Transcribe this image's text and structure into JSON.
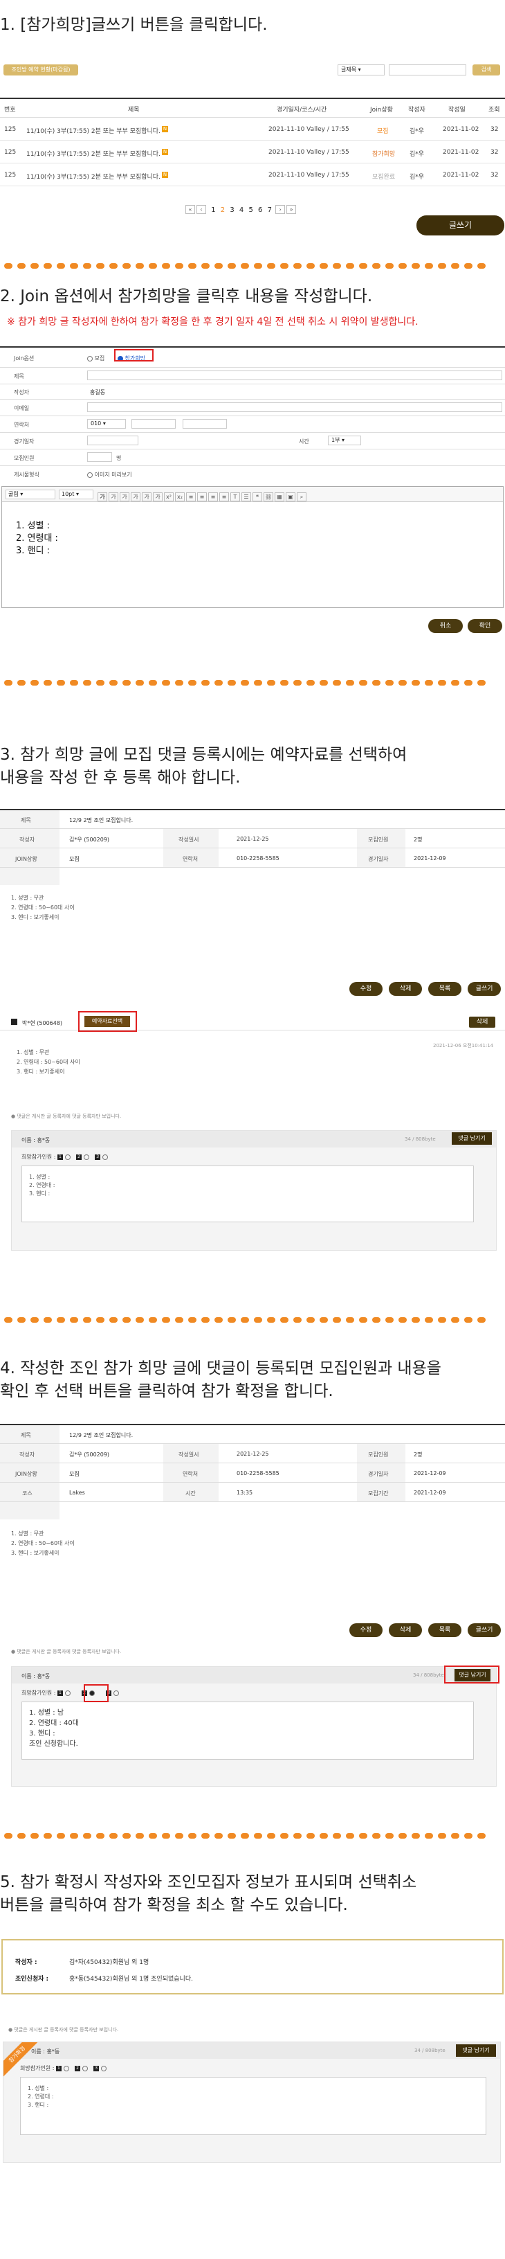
{
  "s1": {
    "heading": "1. [참가희망]글쓰기 버튼을 클릭합니다.",
    "filter_btn": "조인방 예약 현황(마감됨)",
    "search_select": "글제목",
    "search_btn": "검색",
    "cols": [
      "번호",
      "제목",
      "경기일자/코스/시간",
      "Join상황",
      "작성자",
      "작성일",
      "조회"
    ],
    "rows": [
      {
        "no": "125",
        "title": "11/10(수) 3부(17:55) 2분 또는 부부 모집합니다.",
        "info": "2021-11-10 Valley / 17:55",
        "status": "모집",
        "author": "김*우",
        "date": "2021-11-02",
        "views": "32"
      },
      {
        "no": "125",
        "title": "11/10(수) 3부(17:55) 2분 또는 부부 모집합니다.",
        "info": "2021-11-10 Valley / 17:55",
        "status": "참가희망",
        "author": "김*우",
        "date": "2021-11-02",
        "views": "32"
      },
      {
        "no": "125",
        "title": "11/10(수) 3부(17:55) 2분 또는 부부 모집합니다.",
        "info": "2021-11-10 Valley / 17:55",
        "status": "모집완료",
        "author": "김*우",
        "date": "2021-11-02",
        "views": "32"
      }
    ],
    "pages": [
      "1",
      "2",
      "3",
      "4",
      "5",
      "6",
      "7"
    ],
    "write_btn": "글쓰기"
  },
  "s2": {
    "heading": "2. Join 옵션에서 참가희망을 클릭후 내용을 작성합니다.",
    "warn": "※ 참가 희망 글 작성자에 한하여 참가 확정을 한 후 경기 일자 4일 전 선택 취소 시 위약이 발생합니다.",
    "labels": [
      "Join옵션",
      "제목",
      "작성자",
      "이메일",
      "연락처",
      "경기일자",
      "모집인원",
      "게시물형식"
    ],
    "opt1": "모집",
    "opt2": "참가희망",
    "author": "홍길동",
    "phone": "010",
    "time_label": "시간",
    "time_val": "1부",
    "people_unit": "명",
    "format_opt": "이미지 미리보기",
    "font": "굴림",
    "size": "10pt",
    "body": [
      "1. 성별 :",
      "2. 연령대 :",
      "3. 핸디 :"
    ],
    "cancel": "취소",
    "ok": "확인"
  },
  "s3": {
    "heading1": "3. 참가 희망 글에 모집 댓글 등록시에는 예약자료를 선택하여",
    "heading2": "내용을 작성 한 후 등록 해야 합니다.",
    "title_label": "제목",
    "title_val": "12/9 2명 조인 모집합니다.",
    "r1": [
      "작성자",
      "김*우 (500209)",
      "작성일시",
      "2021-12-25",
      "모집인원",
      "2명"
    ],
    "r2": [
      "JOIN상황",
      "모집",
      "연락처",
      "010-2258-5585",
      "경기일자",
      "2021-12-09"
    ],
    "body": [
      "1. 성별 : 무관",
      "2. 연령대 : 50~60대 사이",
      "3. 핸디 : 보기좋세이"
    ],
    "btns": [
      "수정",
      "삭제",
      "목록",
      "글쓰기"
    ],
    "commenter": "박*현 (500648)",
    "reserve_btn": "예약자료선택",
    "del_btn": "삭제",
    "datetime": "2021-12-06 오전10:41:14",
    "cbody": [
      "1. 성별 : 무관",
      "2. 연령대 : 50~60대 사이",
      "3. 핸디 : 보기좋세이"
    ],
    "notice": "● 댓글은 게시판 글 등록자에 댓글 등록자만 보입니다.",
    "name": "이름 : 홍*동",
    "counter": "34 / 808byte",
    "reply_btn": "댓글 남기기",
    "pick_label": "희망참가인원 :",
    "picks": [
      "1",
      "2",
      "3"
    ],
    "tbody": [
      "1. 성별 :",
      "2. 연령대 :",
      "3. 핸디 :"
    ]
  },
  "s4": {
    "heading1": "4. 작성한 조인 참가 희망 글에 댓글이 등록되면 모집인원과 내용을",
    "heading2": "확인 후 선택 버튼을 클릭하여 참가 확정을 합니다.",
    "title_label": "제목",
    "title_val": "12/9 2명 조인 모집합니다.",
    "r1": [
      "작성자",
      "김*우 (500209)",
      "작성일시",
      "2021-12-25",
      "모집인원",
      "2명"
    ],
    "r2": [
      "JOIN상황",
      "모집",
      "연락처",
      "010-2258-5585",
      "경기일자",
      "2021-12-09"
    ],
    "r3": [
      "코스",
      "Lakes",
      "시간",
      "13:35",
      "모집기간",
      "2021-12-09"
    ],
    "body": [
      "1. 성별 : 무관",
      "2. 연령대 : 50~60대 사이",
      "3. 핸디 : 보기좋세이"
    ],
    "btns": [
      "수정",
      "삭제",
      "목록",
      "글쓰기"
    ],
    "notice": "● 댓글은 게시판 글 등록자에 댓글 등록자만 보입니다.",
    "name": "이름 : 홍*동",
    "counter": "34 / 808byte",
    "reply_btn": "댓글 남기기",
    "pick_label": "희망참가인원 :",
    "picks": [
      "1",
      "2",
      "3"
    ],
    "tbody": [
      "1. 성별 : 남",
      "2. 연령대 : 40대",
      "3. 핸디 :",
      "조인 신청합니다."
    ]
  },
  "s5": {
    "heading1": "5. 참가 확정시 작성자와 조인모집자 정보가 표시되며 선택취소",
    "heading2": "버튼을 클릭하여 참가 확정을 최소 할 수도 있습니다.",
    "author_label": "작성자 :",
    "author_val": "김*자(450432)회원님 외 1명",
    "joiner_label": "조인신청자 :",
    "joiner_val": "홍*동(545432)회원님 외 1명 조인되었습니다.",
    "notice": "● 댓글은 게시판 글 등록자에 댓글 등록자만 보입니다.",
    "ribbon": "참가확정",
    "name": "이름 : 홍*동",
    "counter": "34 / 808byte",
    "reply_btn": "댓글 남기기",
    "pick_label": "희망참가인원 :",
    "picks": [
      "1",
      "2",
      "3"
    ],
    "tbody": [
      "1. 성별 :",
      "2. 연령대 :",
      "3. 핸디 :"
    ]
  },
  "colors": {
    "accent_orange": "#f08a24",
    "brown": "#3e2f0a",
    "red": "#e02020",
    "gold": "#d9b96a"
  }
}
